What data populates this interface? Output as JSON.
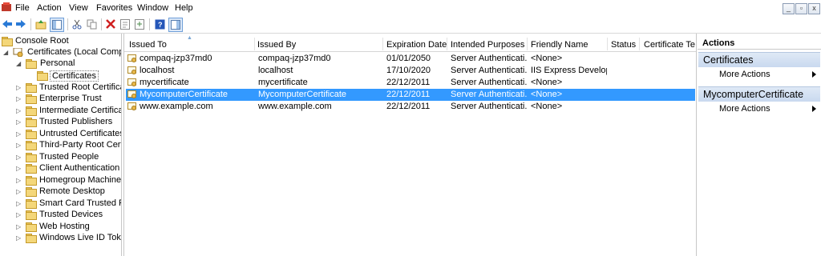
{
  "menu": [
    "File",
    "Action",
    "View",
    "Favorites",
    "Window",
    "Help"
  ],
  "window_controls": {
    "minimize": "_",
    "restore": "▫",
    "close": "x"
  },
  "toolbar_icons": [
    "back-icon",
    "forward-icon",
    "up-folder-icon",
    "show-hide-tree-icon",
    "cut-icon",
    "copy-icon",
    "delete-icon",
    "properties-icon",
    "export-icon",
    "help-icon",
    "show-hide-action-pane-icon"
  ],
  "tree": {
    "root": "Console Root",
    "store": "Certificates (Local Compute",
    "personal": "Personal",
    "selected": "Certificates",
    "folders": [
      "Trusted Root Certificatio",
      "Enterprise Trust",
      "Intermediate Certificatio",
      "Trusted Publishers",
      "Untrusted Certificates",
      "Third-Party Root Certific",
      "Trusted People",
      "Client Authentication Iss",
      "Homegroup Machine C",
      "Remote Desktop",
      "Smart Card Trusted Roo",
      "Trusted Devices",
      "Web Hosting",
      "Windows Live ID Token"
    ]
  },
  "columns": [
    "Issued To",
    "Issued By",
    "Expiration Date",
    "Intended Purposes",
    "Friendly Name",
    "Status",
    "Certificate Te..."
  ],
  "rows": [
    {
      "issued_to": "compaq-jzp37md0",
      "issued_by": "compaq-jzp37md0",
      "expiration": "01/01/2050",
      "purposes": "Server Authenticati...",
      "friendly": "<None>"
    },
    {
      "issued_to": "localhost",
      "issued_by": "localhost",
      "expiration": "17/10/2020",
      "purposes": "Server Authenticati...",
      "friendly": "IIS Express Develop..."
    },
    {
      "issued_to": "mycertificate",
      "issued_by": "mycertificate",
      "expiration": "22/12/2011",
      "purposes": "Server Authenticati...",
      "friendly": "<None>"
    },
    {
      "issued_to": "MycomputerCertificate",
      "issued_by": "MycomputerCertificate",
      "expiration": "22/12/2011",
      "purposes": "Server Authenticati...",
      "friendly": "<None>"
    },
    {
      "issued_to": "www.example.com",
      "issued_by": "www.example.com",
      "expiration": "22/12/2011",
      "purposes": "Server Authenticati...",
      "friendly": "<None>"
    }
  ],
  "actions": {
    "title": "Actions",
    "section1": "Certificates",
    "section1_item": "More Actions",
    "section2": "MycomputerCertificate",
    "section2_item": "More Actions"
  },
  "colors": {
    "selection": "#3399ff",
    "action_header": "#c9d9ef"
  }
}
